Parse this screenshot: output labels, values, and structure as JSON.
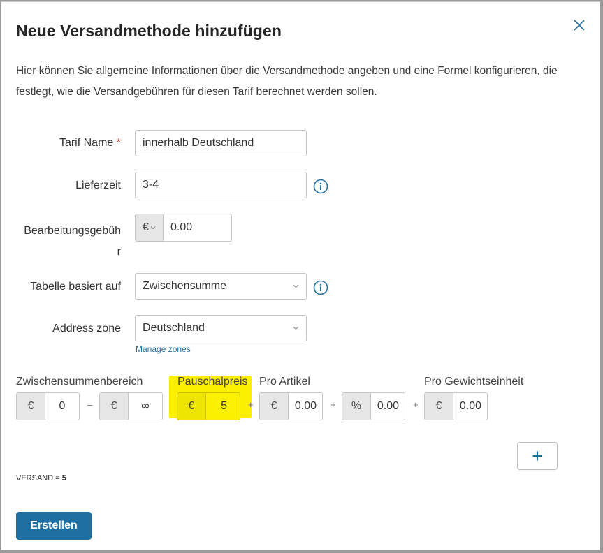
{
  "dialog": {
    "title": "Neue Versandmethode hinzufügen",
    "description": "Hier können Sie allgemeine Informationen über die Versandmethode angeben und eine Formel konfigurieren, die festlegt, wie die Versandgebühren für diesen Tarif berechnet werden sollen."
  },
  "form": {
    "tarif_name": {
      "label": "Tarif Name",
      "required_mark": "*",
      "value": "innerhalb Deutschland"
    },
    "lieferzeit": {
      "label": "Lieferzeit",
      "value": "3-4"
    },
    "bearbeitungsgebuehr": {
      "label_line1": "Bearbeitungsgebüh",
      "label_line2": "r",
      "currency": "€",
      "value": "0.00"
    },
    "tabelle": {
      "label": "Tabelle basiert auf",
      "value": "Zwischensumme"
    },
    "address_zone": {
      "label": "Address zone",
      "value": "Deutschland",
      "manage_link": "Manage zones"
    }
  },
  "rate": {
    "headers": {
      "zwischensummenbereich": "Zwischensummenbereich",
      "pauschalpreis": "Pauschalpreis",
      "pro_artikel": "Pro Artikel",
      "pro_gewichtseinheit": "Pro Gewichtseinheit"
    },
    "from": {
      "symbol": "€",
      "value": "0"
    },
    "range_sep": "–",
    "to": {
      "symbol": "€",
      "value": "∞"
    },
    "flat": {
      "symbol": "€",
      "value": "5"
    },
    "plus": "+",
    "per_item": {
      "symbol": "€",
      "value": "0.00"
    },
    "percent": {
      "symbol": "%",
      "value": "0.00"
    },
    "per_weight": {
      "symbol": "€",
      "value": "0.00"
    }
  },
  "formula": {
    "label": "VERSAND = ",
    "value": "5"
  },
  "buttons": {
    "submit": "Erstellen"
  },
  "colors": {
    "primary": "#1f6fa3",
    "highlight": "#fbf000",
    "required": "#c0392b",
    "info": "#1f6f9f"
  }
}
